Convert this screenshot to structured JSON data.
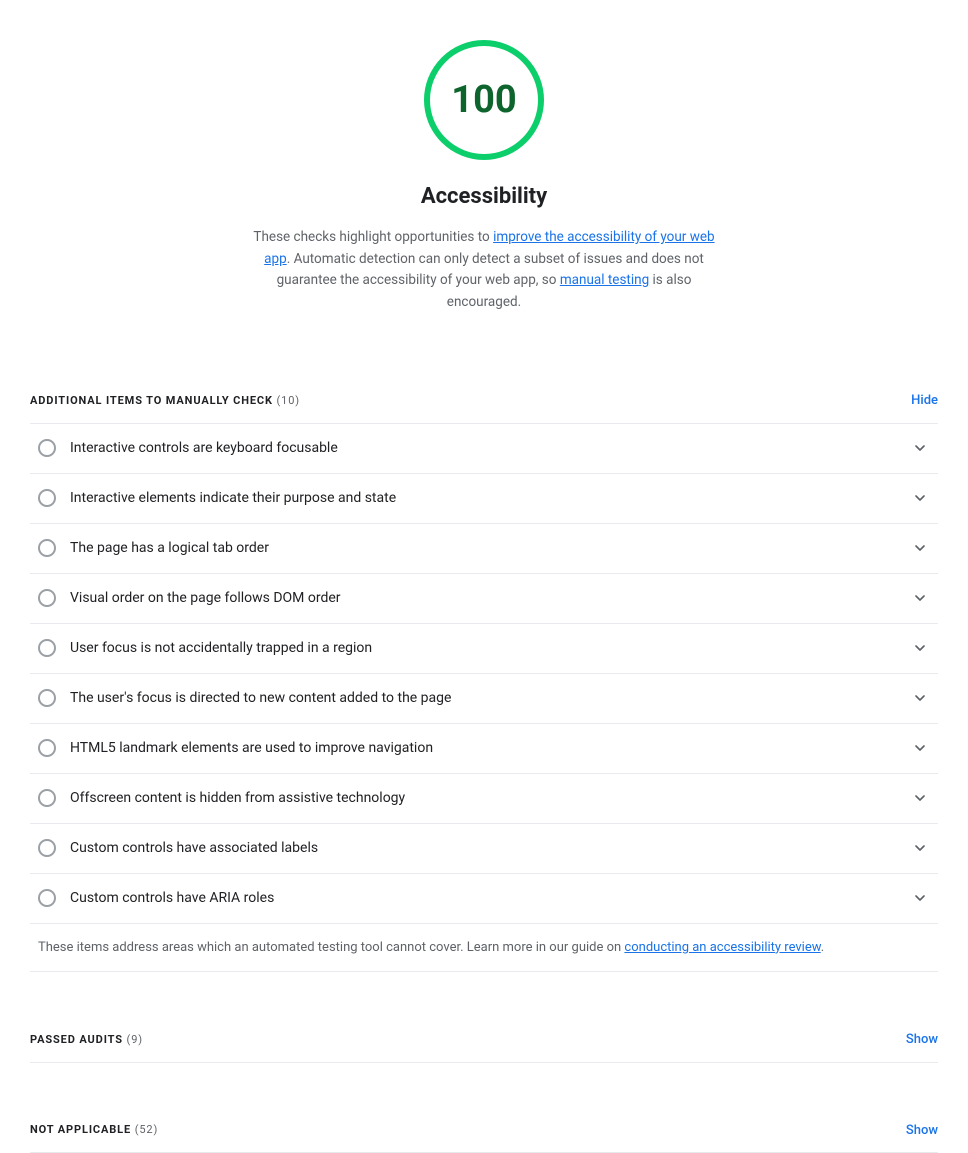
{
  "score": {
    "value": "100",
    "label": "Accessibility",
    "circle_color": "#0cce6b",
    "number_color": "#0d652d",
    "description_before": "These checks highlight opportunities to ",
    "link1_text": "improve the accessibility of your web app",
    "link1_href": "#",
    "description_middle": ". Automatic detection can only detect a subset of issues and does not guarantee the accessibility of your web app, so ",
    "link2_text": "manual testing",
    "link2_href": "#",
    "description_after": " is also encouraged."
  },
  "manual_section": {
    "title": "ADDITIONAL ITEMS TO MANUALLY CHECK",
    "count": "(10)",
    "action_label": "Hide"
  },
  "audit_items": [
    {
      "id": 1,
      "label": "Interactive controls are keyboard focusable"
    },
    {
      "id": 2,
      "label": "Interactive elements indicate their purpose and state"
    },
    {
      "id": 3,
      "label": "The page has a logical tab order"
    },
    {
      "id": 4,
      "label": "Visual order on the page follows DOM order"
    },
    {
      "id": 5,
      "label": "User focus is not accidentally trapped in a region"
    },
    {
      "id": 6,
      "label": "The user's focus is directed to new content added to the page"
    },
    {
      "id": 7,
      "label": "HTML5 landmark elements are used to improve navigation"
    },
    {
      "id": 8,
      "label": "Offscreen content is hidden from assistive technology"
    },
    {
      "id": 9,
      "label": "Custom controls have associated labels"
    },
    {
      "id": 10,
      "label": "Custom controls have ARIA roles"
    }
  ],
  "manual_footer": {
    "text_before": "These items address areas which an automated testing tool cannot cover. Learn more in our guide on ",
    "link_text": "conducting an accessibility review",
    "link_href": "#",
    "text_after": "."
  },
  "passed_section": {
    "title": "PASSED AUDITS",
    "count": "(9)",
    "action_label": "Show"
  },
  "not_applicable_section": {
    "title": "NOT APPLICABLE",
    "count": "(52)",
    "action_label": "Show"
  }
}
